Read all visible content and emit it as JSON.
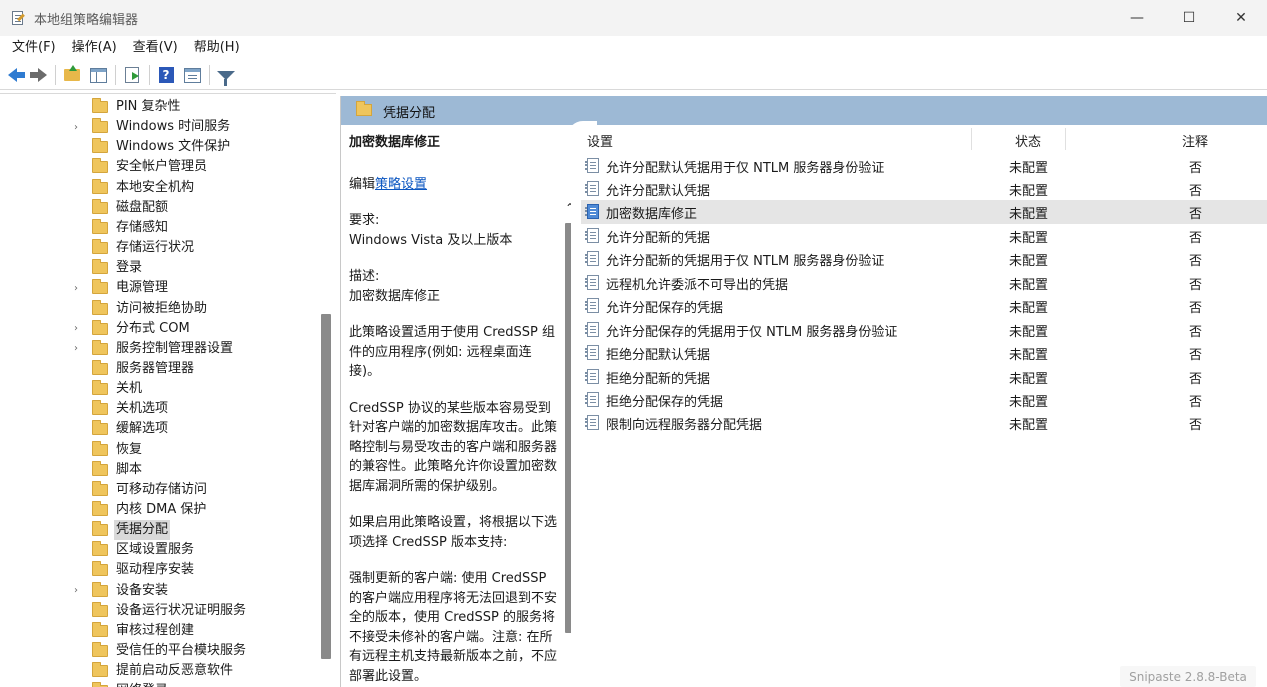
{
  "window": {
    "title": "本地组策略编辑器",
    "minimize_glyph": "—",
    "maximize_glyph": "☐",
    "close_glyph": "✕"
  },
  "menu": [
    "文件(F)",
    "操作(A)",
    "查看(V)",
    "帮助(H)"
  ],
  "toolbar": {
    "buttons": [
      "back-icon",
      "forward-icon",
      "up-folder-icon",
      "show-hide-tree-icon",
      "export-list-icon",
      "help-icon",
      "properties-icon",
      "filter-icon"
    ],
    "help_glyph": "?"
  },
  "tree": {
    "items": [
      {
        "label": "PIN 复杂性",
        "expandable": false
      },
      {
        "label": "Windows 时间服务",
        "expandable": true
      },
      {
        "label": "Windows 文件保护",
        "expandable": false
      },
      {
        "label": "安全帐户管理员",
        "expandable": false
      },
      {
        "label": "本地安全机构",
        "expandable": false
      },
      {
        "label": "磁盘配额",
        "expandable": false
      },
      {
        "label": "存储感知",
        "expandable": false
      },
      {
        "label": "存储运行状况",
        "expandable": false
      },
      {
        "label": "登录",
        "expandable": false
      },
      {
        "label": "电源管理",
        "expandable": true
      },
      {
        "label": "访问被拒绝协助",
        "expandable": false
      },
      {
        "label": "分布式 COM",
        "expandable": true
      },
      {
        "label": "服务控制管理器设置",
        "expandable": true
      },
      {
        "label": "服务器管理器",
        "expandable": false
      },
      {
        "label": "关机",
        "expandable": false
      },
      {
        "label": "关机选项",
        "expandable": false
      },
      {
        "label": "缓解选项",
        "expandable": false
      },
      {
        "label": "恢复",
        "expandable": false
      },
      {
        "label": "脚本",
        "expandable": false
      },
      {
        "label": "可移动存储访问",
        "expandable": false
      },
      {
        "label": "内核 DMA 保护",
        "expandable": false
      },
      {
        "label": "凭据分配",
        "expandable": false,
        "selected": true
      },
      {
        "label": "区域设置服务",
        "expandable": false
      },
      {
        "label": "驱动程序安装",
        "expandable": false
      },
      {
        "label": "设备安装",
        "expandable": true
      },
      {
        "label": "设备运行状况证明服务",
        "expandable": false
      },
      {
        "label": "审核过程创建",
        "expandable": false
      },
      {
        "label": "受信任的平台模块服务",
        "expandable": false
      },
      {
        "label": "提前启动反恶意软件",
        "expandable": false
      },
      {
        "label": "网络登录",
        "expandable": false
      }
    ],
    "expand_glyph": "›"
  },
  "right_header": {
    "title": "凭据分配"
  },
  "description": {
    "title": "加密数据库修正",
    "edit_prefix": "编辑",
    "edit_link": "策略设置",
    "req_label": "要求:",
    "req_value": "Windows Vista 及以上版本",
    "desc_label": "描述:",
    "desc_value": "加密数据库修正",
    "para1": "此策略设置适用于使用 CredSSP 组件的应用程序(例如: 远程桌面连接)。",
    "para2": "CredSSP 协议的某些版本容易受到针对客户端的加密数据库攻击。此策略控制与易受攻击的客户端和服务器的兼容性。此策略允许你设置加密数据库漏洞所需的保护级别。",
    "para3": "如果启用此策略设置，将根据以下选项选择 CredSSP 版本支持:",
    "para4": "强制更新的客户端: 使用 CredSSP 的客户端应用程序将无法回退到不安全的版本，使用 CredSSP 的服务将不接受未修补的客户端。注意: 在所有远程主机支持最新版本之前，不应部署此设置。",
    "scroll_up_glyph": "⌃"
  },
  "list": {
    "columns": [
      "设置",
      "状态",
      "注释"
    ],
    "rows": [
      {
        "name": "允许分配默认凭据用于仅 NTLM 服务器身份验证",
        "state": "未配置",
        "note": "否"
      },
      {
        "name": "允许分配默认凭据",
        "state": "未配置",
        "note": "否"
      },
      {
        "name": "加密数据库修正",
        "state": "未配置",
        "note": "否",
        "selected": true
      },
      {
        "name": "允许分配新的凭据",
        "state": "未配置",
        "note": "否"
      },
      {
        "name": "允许分配新的凭据用于仅 NTLM 服务器身份验证",
        "state": "未配置",
        "note": "否"
      },
      {
        "name": "远程机允许委派不可导出的凭据",
        "state": "未配置",
        "note": "否"
      },
      {
        "name": "允许分配保存的凭据",
        "state": "未配置",
        "note": "否"
      },
      {
        "name": "允许分配保存的凭据用于仅 NTLM 服务器身份验证",
        "state": "未配置",
        "note": "否"
      },
      {
        "name": "拒绝分配默认凭据",
        "state": "未配置",
        "note": "否"
      },
      {
        "name": "拒绝分配新的凭据",
        "state": "未配置",
        "note": "否"
      },
      {
        "name": "拒绝分配保存的凭据",
        "state": "未配置",
        "note": "否"
      },
      {
        "name": "限制向远程服务器分配凭据",
        "state": "未配置",
        "note": "否"
      }
    ]
  },
  "watermark": "Snipaste 2.8.8-Beta",
  "colors": {
    "header_bar": "#9db9d5",
    "link": "#0b56c1",
    "selection": "#e5e5e5",
    "folder": "#efc55c"
  }
}
